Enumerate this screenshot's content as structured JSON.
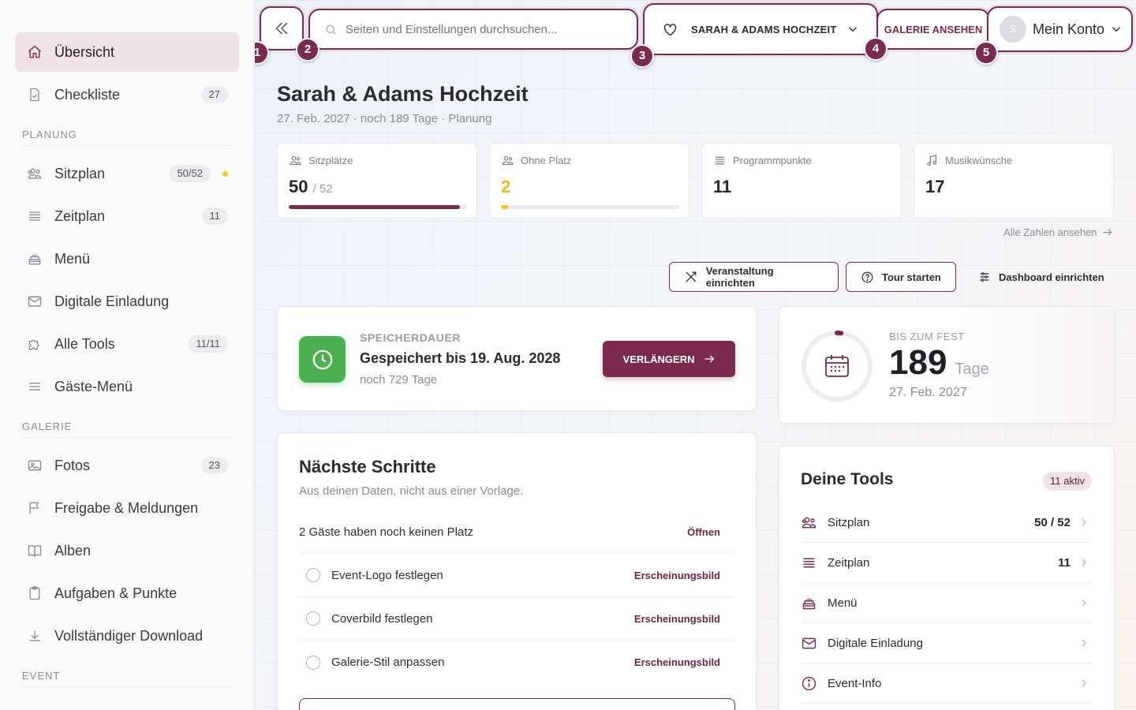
{
  "sidebar": {
    "items_top": [
      {
        "label": "Übersicht",
        "icon": "home-icon",
        "active": true
      },
      {
        "label": "Checkliste",
        "icon": "checklist-icon",
        "badge": "27"
      }
    ],
    "sections": [
      {
        "heading": "PLANUNG",
        "items": [
          {
            "label": "Sitzplan",
            "icon": "users-icon",
            "badge": "50/52",
            "dot": true
          },
          {
            "label": "Zeitplan",
            "icon": "list-icon",
            "badge": "11"
          },
          {
            "label": "Menü",
            "icon": "cake-icon"
          },
          {
            "label": "Digitale Einladung",
            "icon": "mail-icon"
          },
          {
            "label": "Alle Tools",
            "icon": "puzzle-icon",
            "badge": "11/11"
          },
          {
            "label": "Gäste-Menü",
            "icon": "menu-icon"
          }
        ]
      },
      {
        "heading": "GALERIE",
        "items": [
          {
            "label": "Fotos",
            "icon": "image-icon",
            "badge": "23"
          },
          {
            "label": "Freigabe & Meldungen",
            "icon": "flag-icon"
          },
          {
            "label": "Alben",
            "icon": "book-icon"
          },
          {
            "label": "Aufgaben & Punkte",
            "icon": "clipboard-icon"
          },
          {
            "label": "Vollständiger Download",
            "icon": "download-icon"
          }
        ]
      },
      {
        "heading": "EVENT",
        "items": []
      }
    ]
  },
  "topbar": {
    "search_placeholder": "Seiten und Einstellungen durchsuchen...",
    "event_selector": "SARAH & ADAMS HOCHZEIT",
    "gallery_button": "GALERIE ANSEHEN",
    "account_initial": "S",
    "account_label": "Mein Konto",
    "markers": [
      "1",
      "2",
      "3",
      "4",
      "5"
    ]
  },
  "header": {
    "title": "Sarah & Adams Hochzeit",
    "subtitle": "27. Feb. 2027 · noch 189 Tage · Planung"
  },
  "stats": [
    {
      "label": "Sitzplätze",
      "value": "50",
      "of": "/ 52",
      "progress": 0.96,
      "color": "#7a2a4c"
    },
    {
      "label": "Ohne Platz",
      "value": "2",
      "progress": 0.04,
      "color": "#f2c12e"
    },
    {
      "label": "Programmpunkte",
      "value": "11"
    },
    {
      "label": "Musikwünsche",
      "value": "17"
    }
  ],
  "all_numbers_link": "Alle Zahlen ansehen",
  "actions": {
    "setup_event": "Veranstaltung einrichten",
    "tour": "Tour starten",
    "dashboard": "Dashboard einrichten"
  },
  "storage": {
    "kicker": "SPEICHERDAUER",
    "title": "Gespeichert bis 19. Aug. 2028",
    "sub": "noch 729 Tage",
    "button": "VERLÄNGERN"
  },
  "countdown": {
    "kicker": "BIS ZUM FEST",
    "value": "189",
    "unit": "Tage",
    "date": "27. Feb. 2027",
    "progress": 0.02
  },
  "next_steps": {
    "title": "Nächste Schritte",
    "subtitle": "Aus deinen Daten, nicht aus einer Vorlage.",
    "rows": [
      {
        "label": "2 Gäste haben noch keinen Platz",
        "action": "Öffnen",
        "checkbox": false
      },
      {
        "label": "Event-Logo festlegen",
        "action": "Erscheinungsbild",
        "checkbox": true
      },
      {
        "label": "Coverbild festlegen",
        "action": "Erscheinungsbild",
        "checkbox": true
      },
      {
        "label": "Galerie-Stil anpassen",
        "action": "Erscheinungsbild",
        "checkbox": true
      }
    ]
  },
  "tools": {
    "title": "Deine Tools",
    "badge": "11 aktiv",
    "rows": [
      {
        "label": "Sitzplan",
        "value": "50 / 52",
        "icon": "users-icon"
      },
      {
        "label": "Zeitplan",
        "value": "11",
        "icon": "list-icon"
      },
      {
        "label": "Menü",
        "value": "",
        "icon": "cake-icon"
      },
      {
        "label": "Digitale Einladung",
        "value": "",
        "icon": "mail-icon"
      },
      {
        "label": "Event-Info",
        "value": "",
        "icon": "info-icon"
      }
    ]
  }
}
